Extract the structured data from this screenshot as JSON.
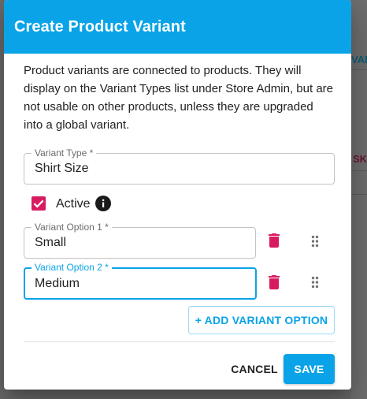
{
  "background": {
    "fragment_top": "VAI",
    "fragment_mid": "SKI"
  },
  "dialog": {
    "title": "Create Product Variant",
    "description": "Product variants are connected to products. They will display on the Variant Types list under Store Admin, but are not usable on other products, unless they are upgraded into a global variant.",
    "variant_type": {
      "label": "Variant Type *",
      "value": "Shirt Size"
    },
    "active": {
      "label": "Active",
      "checked": true
    },
    "options": [
      {
        "label": "Variant Option 1 *",
        "value": "Small"
      },
      {
        "label": "Variant Option 2 *",
        "value": "Medium",
        "focused": true
      }
    ],
    "add_option_label": "+ ADD VARIANT OPTION",
    "cancel_label": "CANCEL",
    "save_label": "SAVE"
  },
  "colors": {
    "primary": "#0aa3e8",
    "accent": "#d81b60",
    "backdrop": "#6f6f6f"
  },
  "icons": {
    "info": "info-icon",
    "delete": "trash-icon",
    "reorder": "drag-handle-icon",
    "check": "check-icon"
  }
}
